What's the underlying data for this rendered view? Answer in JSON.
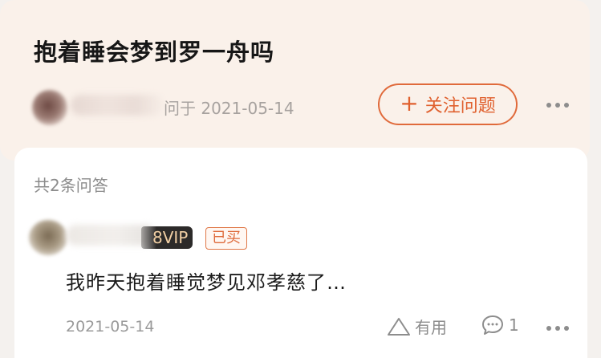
{
  "question": {
    "title": "抱着睡会梦到罗一舟吗",
    "asked_meta": "问于 2021-05-14",
    "follow_label": "关注问题",
    "follow_icon": "plus-icon"
  },
  "answers": {
    "count_label": "共2条问答",
    "items": [
      {
        "vip_badge": "8VIP",
        "purchased_badge": "已买",
        "excerpt": "我昨天抱着睡觉梦见邓孝慈了…",
        "date": "2021-05-14",
        "useful_label": "有用",
        "comment_count": "1"
      }
    ]
  },
  "colors": {
    "accent": "#e0602e",
    "question_bg": "#faf1ea",
    "vip_text": "#f1cfa4"
  },
  "icons": {
    "useful": "triangle-up-icon",
    "comment": "comment-bubble-icon",
    "more": "more-dots-icon"
  }
}
